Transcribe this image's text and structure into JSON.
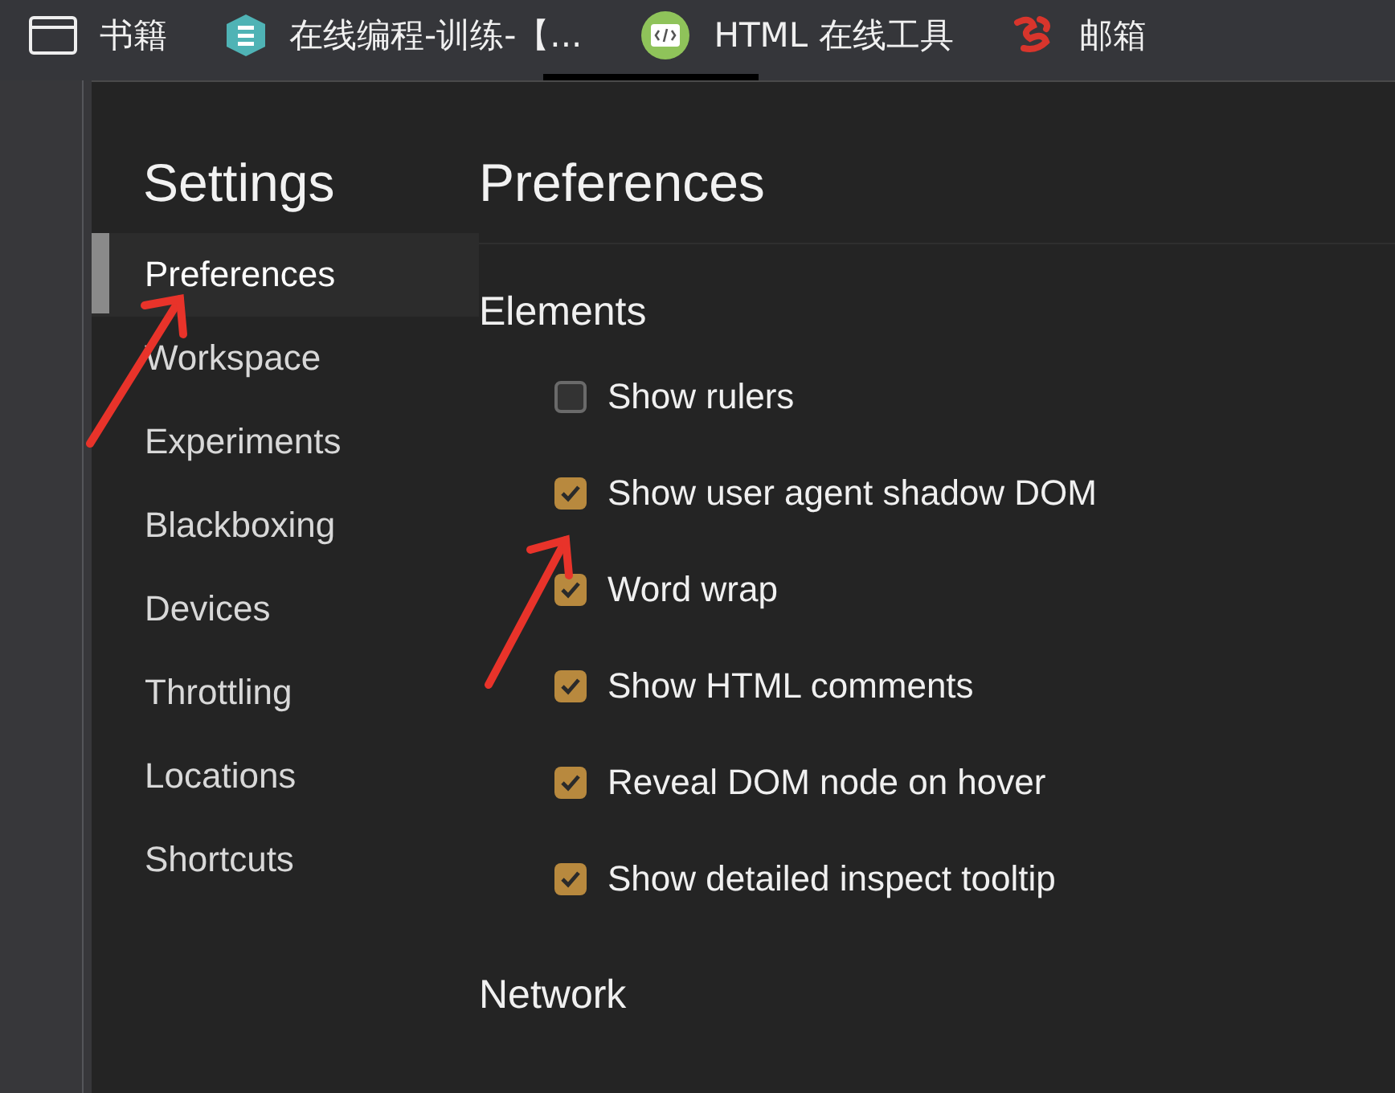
{
  "bookmarks": [
    {
      "kind": "window",
      "label": "书籍"
    },
    {
      "kind": "hexagon",
      "label": "在线编程-训练-【..."
    },
    {
      "kind": "code",
      "label": "HTML 在线工具"
    },
    {
      "kind": "squiggle",
      "label": "邮箱"
    }
  ],
  "sidebar": {
    "title": "Settings",
    "items": [
      {
        "label": "Preferences",
        "selected": true
      },
      {
        "label": "Workspace",
        "selected": false
      },
      {
        "label": "Experiments",
        "selected": false
      },
      {
        "label": "Blackboxing",
        "selected": false
      },
      {
        "label": "Devices",
        "selected": false
      },
      {
        "label": "Throttling",
        "selected": false
      },
      {
        "label": "Locations",
        "selected": false
      },
      {
        "label": "Shortcuts",
        "selected": false
      }
    ]
  },
  "main": {
    "title": "Preferences",
    "sections": [
      {
        "title": "Elements",
        "options": [
          {
            "label": "Show rulers",
            "checked": false
          },
          {
            "label": "Show user agent shadow DOM",
            "checked": true
          },
          {
            "label": "Word wrap",
            "checked": true
          },
          {
            "label": "Show HTML comments",
            "checked": true
          },
          {
            "label": "Reveal DOM node on hover",
            "checked": true
          },
          {
            "label": "Show detailed inspect tooltip",
            "checked": true
          }
        ]
      },
      {
        "title": "Network"
      }
    ]
  }
}
